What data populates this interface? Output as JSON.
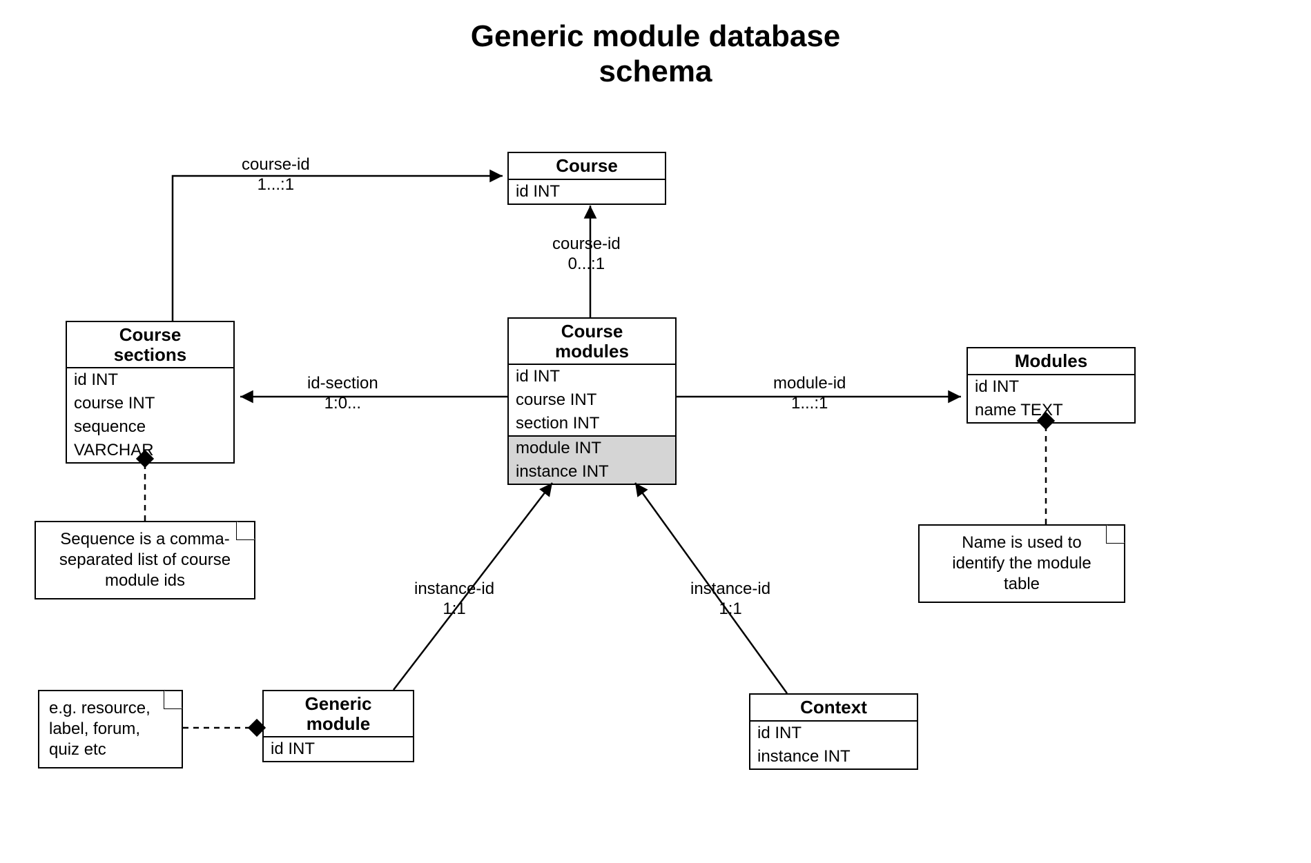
{
  "title_line1": "Generic module database",
  "title_line2": "schema",
  "entities": {
    "course": {
      "name": "Course",
      "fields": [
        "id INT"
      ]
    },
    "course_sections": {
      "name_l1": "Course",
      "name_l2": "sections",
      "fields": [
        "id INT",
        "course INT",
        "sequence",
        "VARCHAR"
      ]
    },
    "course_modules": {
      "name_l1": "Course",
      "name_l2": "modules",
      "fields_top": [
        "id INT",
        "course INT",
        "section INT"
      ],
      "fields_bottom": [
        "module INT",
        "instance INT"
      ]
    },
    "modules": {
      "name": "Modules",
      "fields": [
        "id INT",
        "name TEXT"
      ]
    },
    "generic_module": {
      "name_l1": "Generic",
      "name_l2": "module",
      "fields": [
        "id INT"
      ]
    },
    "context": {
      "name": "Context",
      "fields": [
        "id INT",
        "instance INT"
      ]
    }
  },
  "edges": {
    "cs_to_course": {
      "label": "course-id",
      "card": "1...:1"
    },
    "cm_to_course": {
      "label": "course-id",
      "card": "0...:1"
    },
    "cm_to_cs": {
      "label": "id-section",
      "card": "1:0..."
    },
    "cm_to_modules": {
      "label": "module-id",
      "card": "1...:1"
    },
    "gm_to_cm": {
      "label": "instance-id",
      "card": "1:1"
    },
    "ctx_to_cm": {
      "label": "instance-id",
      "card": "1:1"
    }
  },
  "notes": {
    "sections_note": {
      "l1": "Sequence is a comma-",
      "l2": "separated list of course",
      "l3": "module ids"
    },
    "generic_note": {
      "l1": "e.g. resource,",
      "l2": "label, forum,",
      "l3": "quiz etc"
    },
    "modules_note": {
      "l1": "Name is used to",
      "l2": "identify the module",
      "l3": "table"
    }
  }
}
